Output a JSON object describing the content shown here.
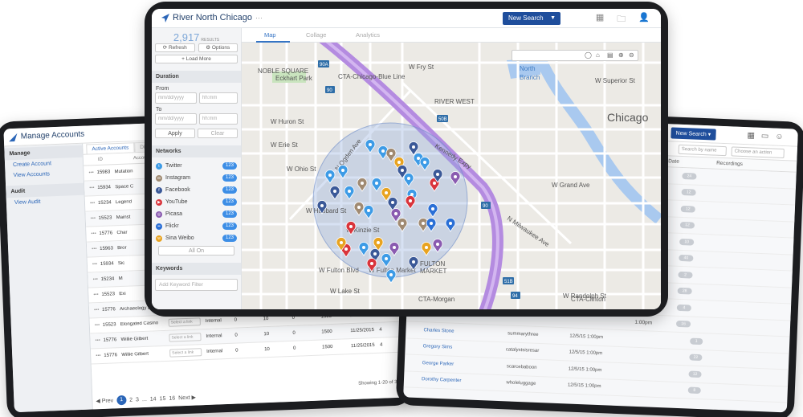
{
  "center": {
    "title": "River North Chicago",
    "more": "···",
    "new_search": "New Search",
    "result_count": "2,917",
    "results_unit": "RESULTS",
    "refresh": "⟳ Refresh",
    "options": "⚙ Options",
    "load_more": "+ Load More",
    "duration_label": "Duration",
    "from_label": "From",
    "to_label": "To",
    "date_placeholder": "mm/dd/yyyy",
    "time_placeholder": "hh:mm",
    "apply": "Apply",
    "clear": "Clear",
    "networks_label": "Networks",
    "networks": [
      {
        "name": "Twitter",
        "count": "123",
        "color": "#3d9be6",
        "glyph": "t"
      },
      {
        "name": "Instagram",
        "count": "123",
        "color": "#a08a72",
        "glyph": "◘"
      },
      {
        "name": "Facebook",
        "count": "123",
        "color": "#3b5998",
        "glyph": "f"
      },
      {
        "name": "YouTube",
        "count": "123",
        "color": "#d9343b",
        "glyph": "▶"
      },
      {
        "name": "Picasa",
        "count": "123",
        "color": "#8a5bb0",
        "glyph": "◎"
      },
      {
        "name": "Flickr",
        "count": "123",
        "color": "#2a6fd6",
        "glyph": "••"
      },
      {
        "name": "Sina Weibo",
        "count": "123",
        "color": "#e8a320",
        "glyph": "w"
      }
    ],
    "all_on": "All On",
    "keywords_label": "Keywords",
    "keyword_placeholder": "Add Keyword Filter",
    "tabs": [
      "Map",
      "Collage",
      "Analytics"
    ],
    "map_labels": [
      {
        "t": "W Fry St"
      },
      {
        "t": "North"
      },
      {
        "t": "Branch"
      },
      {
        "t": "W Superior St"
      },
      {
        "t": "Chicago"
      },
      {
        "t": "RIVER WEST"
      },
      {
        "t": "W Huron St"
      },
      {
        "t": "W Erie St"
      },
      {
        "t": "W Ohio St"
      },
      {
        "t": "W Grand Ave"
      },
      {
        "t": "W Hubbard St"
      },
      {
        "t": "W Kinzie St"
      },
      {
        "t": "W Fulton Blvd"
      },
      {
        "t": "W Fulton Market"
      },
      {
        "t": "W Lake St"
      },
      {
        "t": "W Randolph St"
      },
      {
        "t": "CTA-Chicago-Blue Line"
      },
      {
        "t": "CTA-Morgan"
      },
      {
        "t": "CTA-Clinton"
      },
      {
        "t": "NOBLE SQUARE"
      },
      {
        "t": "Eckhart Park"
      },
      {
        "t": "Kennedy Expy"
      },
      {
        "t": "N Ogden Ave"
      },
      {
        "t": "N Milwaukee Ave"
      },
      {
        "t": "FULTON"
      },
      {
        "t": "MARKET"
      }
    ]
  },
  "left": {
    "app_title": "Manage Accounts",
    "manage_header": "Manage",
    "links": [
      "Create Account",
      "View Accounts"
    ],
    "audit_header": "Audit",
    "audit_link": "View Audit",
    "tab_active": "Active Accounts",
    "tab_other": "Disa",
    "col_id": "ID",
    "col_account": "Account Na",
    "rows": [
      {
        "id": "15983",
        "name": "Mutation"
      },
      {
        "id": "15934",
        "name": "Space C"
      },
      {
        "id": "15234",
        "name": "Legend"
      },
      {
        "id": "15523",
        "name": "Mainst"
      },
      {
        "id": "15776",
        "name": "Char"
      },
      {
        "id": "15963",
        "name": "Bror"
      },
      {
        "id": "15934",
        "name": "Sic"
      },
      {
        "id": "15234",
        "name": "M"
      },
      {
        "id": "15523",
        "name": "Exi"
      },
      {
        "id": "15776",
        "name": "Archaeology a Go Go",
        "link": "Select a link",
        "type": "Internal",
        "a": "0",
        "b": "10",
        "c": "0",
        "d": "1500",
        "date": "11/25/2015",
        "x": "4"
      },
      {
        "id": "15523",
        "name": "Elongated Casino",
        "link": "Select a link",
        "type": "Internal",
        "a": "0",
        "b": "10",
        "c": "0",
        "d": "1500",
        "date": "11/25/2015",
        "x": "4"
      },
      {
        "id": "15776",
        "name": "Willie Gilbert",
        "link": "Select a link",
        "type": "Internal",
        "a": "0",
        "b": "10",
        "c": "0",
        "d": "1500",
        "date": "11/25/2015",
        "x": "4"
      },
      {
        "id": "15776",
        "name": "Willie Gilbert",
        "link": "Select a link",
        "type": "Internal",
        "a": "0",
        "b": "10",
        "c": "0",
        "d": "1500",
        "date": "11/25/2015",
        "x": "4"
      }
    ],
    "showing": "Showing 1-20 of 30",
    "pager": [
      "◀ Prev",
      "1",
      "2",
      "3",
      "...",
      "14",
      "15",
      "16",
      "Next ▶"
    ]
  },
  "right": {
    "new_search": "New Search",
    "search_placeholder": "Search by name",
    "action_placeholder": "Choose an action",
    "col_date": "Date",
    "col_recordings": "Recordings",
    "time_rows": [
      {
        "time": "1:00pm",
        "n": "24"
      },
      {
        "time": "1:00pm",
        "n": "12"
      },
      {
        "time": "1:00pm",
        "n": "12"
      },
      {
        "time": "1:00pm",
        "n": "12"
      },
      {
        "time": "1:00pm",
        "n": "10"
      },
      {
        "time": "1:00pm",
        "n": "40"
      },
      {
        "time": "1:00pm",
        "n": "2"
      },
      {
        "time": "1:00pm",
        "n": "28"
      },
      {
        "time": "1:00pm",
        "n": "4"
      },
      {
        "time": "1:00pm",
        "n": "16"
      }
    ],
    "people": [
      {
        "name": "Charles Stone",
        "user": "summarythree",
        "date": "12/5/15 1:00pm",
        "n": "1"
      },
      {
        "name": "Gregory Sims",
        "user": "catalystsisresar",
        "date": "12/5/15 1:00pm",
        "n": "22"
      },
      {
        "name": "George Parker",
        "user": "scarcebaboon",
        "date": "12/5/15 1:00pm",
        "n": "12"
      },
      {
        "name": "Dorothy Carpenter",
        "user": "wholeluggage",
        "date": "12/5/15 1:00pm",
        "n": "8"
      }
    ]
  }
}
